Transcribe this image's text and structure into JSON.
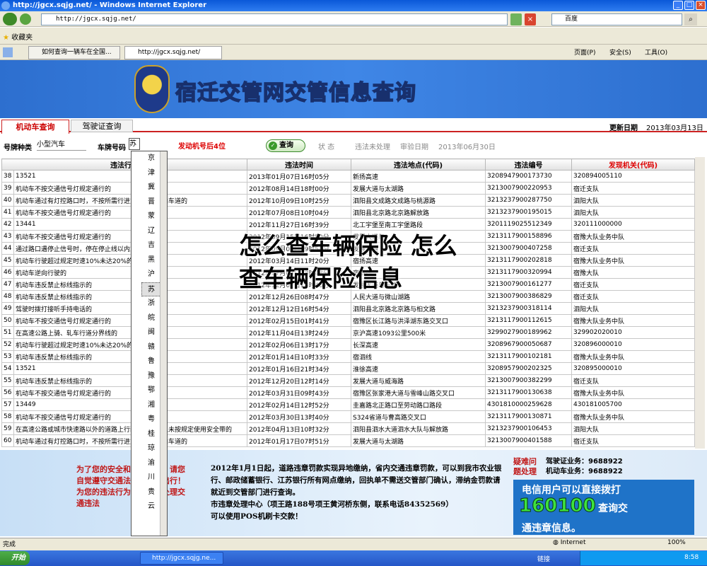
{
  "window": {
    "title": "http://jgcx.sqjg.net/ - Windows Internet Explorer"
  },
  "address": {
    "url": "http://jgcx.sqjg.net/",
    "search_placeholder": "百度"
  },
  "favbar": {
    "favorites": "收藏夹"
  },
  "tabs": [
    {
      "label": "如何查询一辆车在全国..."
    },
    {
      "label": "http://jgcx.sqjg.net/"
    }
  ],
  "toolbar": {
    "page": "页面(P)",
    "safety": "安全(S)",
    "tools": "工具(O)"
  },
  "site": {
    "title": "宿迁交管网交管信息查询",
    "tab_vehicle": "机动车查询",
    "tab_license": "驾驶证查询",
    "update_label": "更新日期",
    "update_value": "2013年03月13日"
  },
  "form": {
    "plate_type_label": "号牌种类",
    "plate_type_value": "小型汽车",
    "plate_no_label": "车牌号码",
    "plate_prefix": "苏",
    "engine_label": "发动机号后4位",
    "query_button": "查询",
    "status_label": "状  态",
    "status_value": "违法未处理",
    "review_label": "审验日期",
    "review_value": "2013年06月30日"
  },
  "table": {
    "headers": [
      "违法行为",
      "违法时间",
      "违法地点(代码)",
      "违法编号",
      "发现机关(代码)"
    ],
    "rows": [
      [
        "38",
        "13521",
        "2013年01月07日16时05分",
        "新扬高速",
        "3208947900173730",
        "320894005110"
      ],
      [
        "39",
        "机动车不按交通信号灯规定通行的",
        "2012年08月14日18时00分",
        "发展大道与太湖路",
        "3213007900220953",
        "宿迁支队"
      ],
      [
        "40",
        "机动车通过有灯控路口时，不按所需行进方向驶入导向车道的",
        "2012年10月09日10时25分",
        "泗阳县文成路文成路与桃源路",
        "3213237900287750",
        "泗阳大队"
      ],
      [
        "41",
        "机动车不按交通信号灯规定通行的",
        "2012年07月08日10时04分",
        "泗阳县北京路北京路解放路",
        "3213237900195015",
        "泗阳大队"
      ],
      [
        "42",
        "13441",
        "2012年11月27日16时39分",
        "北工宇堡至南工宇堡路段",
        "3201119025512349",
        "320111000000"
      ],
      [
        "43",
        "机动车不按交通信号灯规定通行的",
        "2012年09月15日16时50分",
        "发展大道与",
        "3213117900158896",
        "宿豫大队业务中队"
      ],
      [
        "44",
        "通过路口遇停止信号时，停在停止线以内或路口内的",
        "2012年09月01日09时50分",
        "发展大道",
        "3213007900407258",
        "宿迁支队"
      ],
      [
        "45",
        "机动车行驶超过规定时速10%未达20%的",
        "2012年03月14日11时20分",
        "宿扬高速",
        "3213117900202818",
        "宿豫大队业务中队"
      ],
      [
        "46",
        "机动车逆向行驶的",
        "2012年07月03日08时48分",
        "宿泗线",
        "3213117900320994",
        "宿豫大队"
      ],
      [
        "47",
        "机动车违反禁止标线指示的",
        "2012年12月07日13时46分",
        "发展大道与东路",
        "3213007900161277",
        "宿迁支队"
      ],
      [
        "48",
        "机动车违反禁止标线指示的",
        "2012年12月26日08时47分",
        "人民大道与微山湖路",
        "3213007900386829",
        "宿迁支队"
      ],
      [
        "49",
        "驾驶时拨打接听手持电话的",
        "2012年12月12日16时54分",
        "泗阳县北京路北京路与桕文路",
        "3213237900318114",
        "泗阳大队"
      ],
      [
        "50",
        "机动车不按交通信号灯规定通行的",
        "2012年02月15日01时41分",
        "宿豫区长江路与洪泽湖东路交叉口",
        "3213117900112615",
        "宿豫大队业务中队"
      ],
      [
        "51",
        "在高速公路上骑、轧车行道分界线的",
        "2012年11月04日13时24分",
        "京沪高速1093公里500米",
        "3299027900189962",
        "329902020010"
      ],
      [
        "52",
        "机动车行驶超过规定时速10%未达20%的",
        "2012年02月06日13时17分",
        "长深高速",
        "3208967900050687",
        "320896000010"
      ],
      [
        "53",
        "机动车违反禁止标线指示的",
        "2012年01月14日10时33分",
        "宿泗线",
        "3213117900102181",
        "宿豫大队业务中队"
      ],
      [
        "54",
        "13521",
        "2012年01月16日21时34分",
        "淮徐高速",
        "3208957900202325",
        "320895000010"
      ],
      [
        "55",
        "机动车违反禁止标线指示的",
        "2012年12月20日12时14分",
        "发展大道与威海路",
        "3213007900382299",
        "宿迁支队"
      ],
      [
        "56",
        "机动车不按交通信号灯规定通行的",
        "2012年03月31日09时43分",
        "宿豫区张家港大道与雪峰山路交叉口",
        "3213117900130638",
        "宿豫大队业务中队"
      ],
      [
        "57",
        "13449",
        "2012年02月14日12时52分",
        "圭嘉路北正路口至劳动路口路段",
        "4301810000259628",
        "430181005700"
      ],
      [
        "58",
        "机动车不按交通信号灯规定通行的",
        "2012年03月30日13时40分",
        "S324省道与曹高路交叉口",
        "3213117900130871",
        "宿豫大队业务中队"
      ],
      [
        "59",
        "在高速公路或城市快速路以外的道路上行驶时，驾驶人未按规定使用安全带的",
        "2012年04月13日10时32分",
        "泗阳县泗水大道泗水大队与解放路",
        "3213237900106453",
        "泗阳大队"
      ],
      [
        "60",
        "机动车通过有灯控路口时，不按所需行进方向驶入导向车道的",
        "2012年01月17日07时51分",
        "发展大道与太湖路",
        "3213007900401588",
        "宿迁支队"
      ]
    ]
  },
  "province_list": [
    "京",
    "津",
    "冀",
    "晋",
    "蒙",
    "辽",
    "吉",
    "黑",
    "沪",
    "苏",
    "浙",
    "皖",
    "闽",
    "赣",
    "鲁",
    "豫",
    "鄂",
    "湘",
    "粤",
    "桂",
    "琼",
    "渝",
    "川",
    "贵",
    "云"
  ],
  "province_selected": "苏",
  "notice": {
    "left": "为了您的安全和家庭幸福，请您自觉遵守交通法规，安全出行！为您的违法行为请尽快去处理交通违法",
    "main": "2012年1月1日起，道路违章罚款实现异地缴纳，省内交通违章罚款，可以到我市农业银行、邮政储蓄银行、江苏银行所有网点缴纳，回执单不需送交管部门确认，滞纳金罚款请就近到交管部门进行查询。",
    "main2": "市违章处理中心（项王路188号项王黄河桥东侧，联系电话84352569）",
    "main3": "可以使用POS机刷卡交款！",
    "phone_title1": "疑难问",
    "phone_title2": "题处理",
    "phone1_label": "驾驶证业务：",
    "phone1": "9688922",
    "phone2_label": "机动车业务：",
    "phone2": "9688922",
    "ad1": "电信用户可以直接拨打",
    "ad2": "160100",
    "ad3": "查询交",
    "ad4": "通违章信息。"
  },
  "overlay": {
    "text": "怎么查车辆保险 怎么查车辆保险信息"
  },
  "statusbar": {
    "done": "完成",
    "zone": "Internet",
    "zoom": "100%"
  },
  "taskbar": {
    "start": "开始",
    "task": "http://jgcx.sqjg.ne...",
    "link": "链接",
    "time": "8:58"
  }
}
